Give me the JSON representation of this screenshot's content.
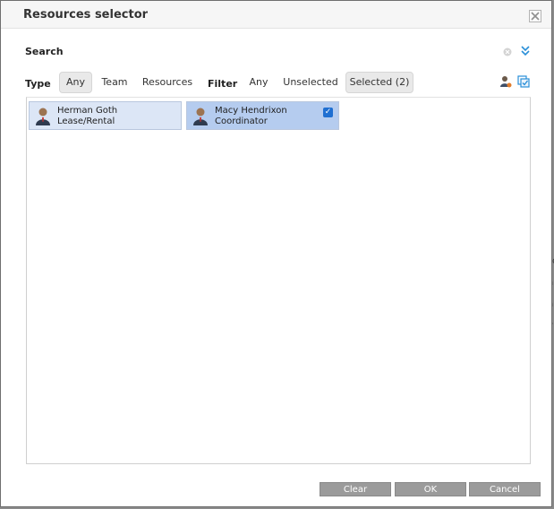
{
  "dialog": {
    "title": "Resources selector",
    "close_icon": "close-icon"
  },
  "search": {
    "label": "Search",
    "clear_icon": "clear-circle-icon",
    "expand_icon": "double-chevron-down-icon"
  },
  "type_filter": {
    "label": "Type",
    "options": [
      "Any",
      "Team",
      "Resources"
    ],
    "selected": "Any"
  },
  "status_filter": {
    "label": "Filter",
    "options": [
      "Any",
      "Unselected",
      "Selected (2)"
    ],
    "selected": "Selected (2)"
  },
  "toolbar_icons": [
    "user-settings-icon",
    "select-all-icon"
  ],
  "resources": [
    {
      "name": "Herman Goth",
      "role": "Lease/Rental",
      "checked": false
    },
    {
      "name": "Macy Hendrixon",
      "role": "Coordinator",
      "checked": true
    }
  ],
  "buttons": {
    "clear": "Clear",
    "ok": "OK",
    "cancel": "Cancel"
  },
  "colors": {
    "card_unchecked_bg": "#dce6f6",
    "card_checked_bg": "#b5ccef",
    "button_bg": "#9b9b9b",
    "checkbox": "#1f6fd1"
  }
}
